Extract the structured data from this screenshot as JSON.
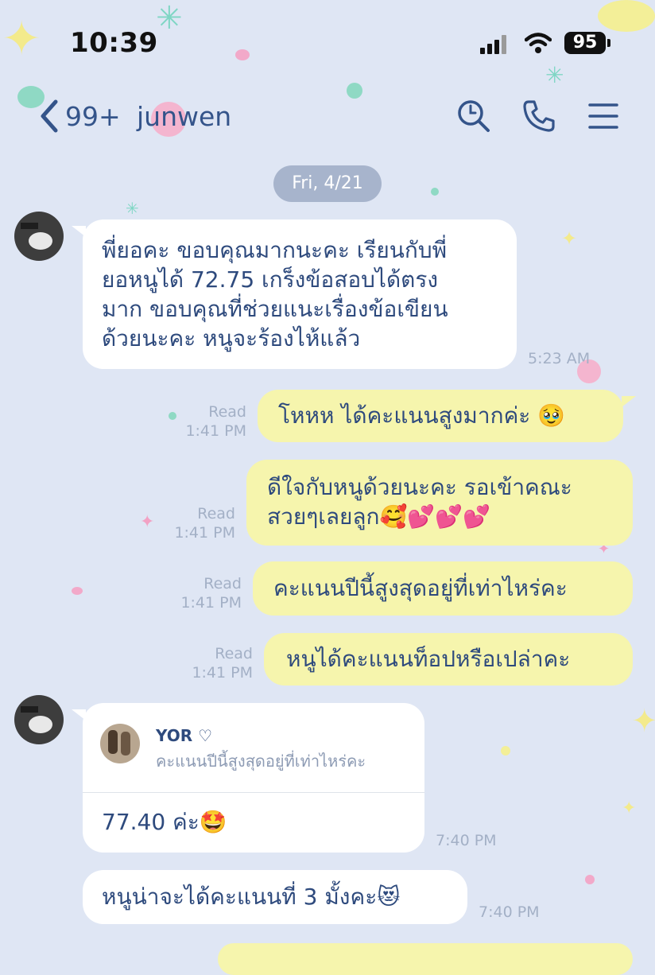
{
  "status": {
    "time": "10:39",
    "battery": "95"
  },
  "header": {
    "unread": "99+",
    "name": "junwen"
  },
  "date_chip": "Fri, 4/21",
  "messages": {
    "m1": {
      "lines": [
        "พี่ยอคะ ขอบคุณมากนะคะ เรียนกับพี่",
        "ยอหนูได้ 72.75 เกร็งข้อสอบได้ตรง",
        "มาก ขอบคุณที่ช่วยแนะเรื่องข้อเขียน",
        "ด้วยนะคะ หนูจะร้องไห้แล้ว"
      ],
      "time": "5:23 AM"
    },
    "m2": {
      "text": "โหหห ได้คะแนนสูงมากค่ะ",
      "emoji": "🥹",
      "read": "Read",
      "time": "1:41 PM"
    },
    "m3": {
      "line1": "ดีใจกับหนูด้วยนะคะ รอเข้าคณะ",
      "line2": "สวยๆเลยลูก",
      "emoji": "🥰💕💕💕",
      "read": "Read",
      "time": "1:41 PM"
    },
    "m4": {
      "text": "คะแนนปีนี้สูงสุดอยู่ที่เท่าไหร่คะ",
      "read": "Read",
      "time": "1:41 PM"
    },
    "m5": {
      "text": "หนูได้คะแนนท็อปหรือเปล่าคะ",
      "read": "Read",
      "time": "1:41 PM"
    },
    "m6": {
      "reply_name": "YOR ♡",
      "reply_text": "คะแนนปีนี้สูงสุดอยู่ที่เท่าไหร่คะ",
      "text": "77.40 ค่ะ",
      "emoji": "🤩",
      "time": "7:40 PM"
    },
    "m7": {
      "text": "หนูน่าจะได้คะแนนที่ 3 มั้งคะ",
      "emoji": "😻",
      "time": "7:40 PM"
    }
  },
  "colors": {
    "background": "#dfe6f4",
    "incoming": "#ffffff",
    "outgoing": "#f6f5ad",
    "text": "#2e4a7d",
    "meta": "#a3b0c6"
  }
}
